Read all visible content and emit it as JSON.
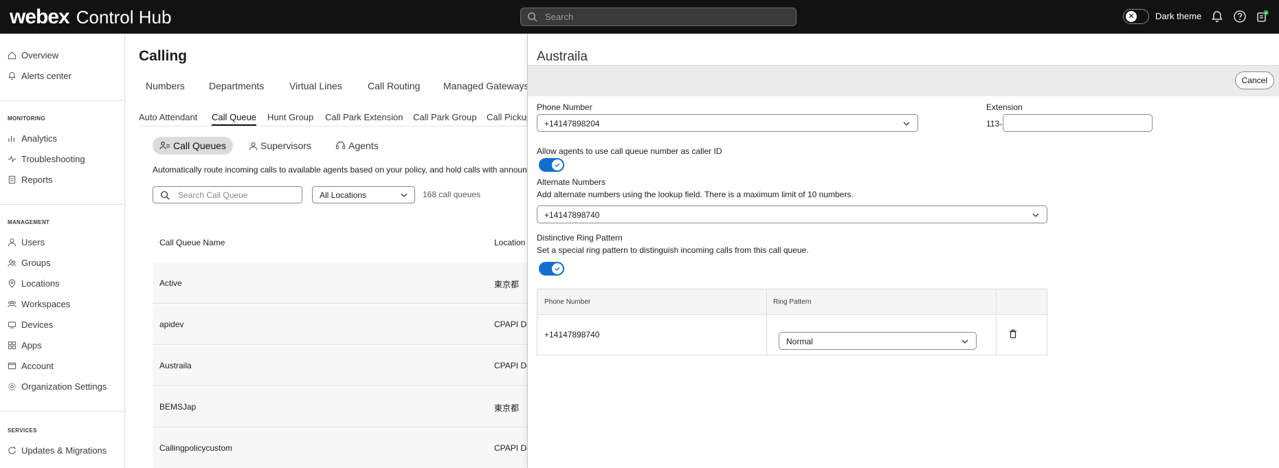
{
  "topbar": {
    "brand": "webex",
    "product": "Control Hub",
    "search_placeholder": "Search",
    "theme_label": "Dark theme"
  },
  "sidebar": {
    "items_top": [
      {
        "label": "Overview",
        "icon": "home-icon"
      },
      {
        "label": "Alerts center",
        "icon": "bell-icon"
      }
    ],
    "monitoring_title": "MONITORING",
    "monitoring": [
      {
        "label": "Analytics",
        "icon": "analytics-icon"
      },
      {
        "label": "Troubleshooting",
        "icon": "pulse-icon"
      },
      {
        "label": "Reports",
        "icon": "report-icon"
      }
    ],
    "management_title": "MANAGEMENT",
    "management": [
      {
        "label": "Users",
        "icon": "user-icon"
      },
      {
        "label": "Groups",
        "icon": "group-icon"
      },
      {
        "label": "Locations",
        "icon": "location-icon"
      },
      {
        "label": "Workspaces",
        "icon": "workspace-icon"
      },
      {
        "label": "Devices",
        "icon": "device-icon"
      },
      {
        "label": "Apps",
        "icon": "apps-icon"
      },
      {
        "label": "Account",
        "icon": "account-icon"
      },
      {
        "label": "Organization Settings",
        "icon": "gear-icon"
      }
    ],
    "services_title": "SERVICES",
    "services": [
      {
        "label": "Updates & Migrations",
        "icon": "refresh-icon"
      }
    ]
  },
  "main": {
    "title": "Calling",
    "tabs": [
      "Numbers",
      "Departments",
      "Virtual Lines",
      "Call Routing",
      "Managed Gateways"
    ],
    "subtabs": [
      "Auto Attendant",
      "Call Queue",
      "Hunt Group",
      "Call Park Extension",
      "Call Park Group",
      "Call Pickup"
    ],
    "active_subtab": "Call Queue",
    "pills": [
      "Call Queues",
      "Supervisors",
      "Agents"
    ],
    "description": "Automatically route incoming calls to available agents based on your policy, and hold calls with announcements",
    "search_placeholder": "Search Call Queue",
    "location_filter": "All Locations",
    "count": "168 call queues",
    "columns": [
      "Call Queue Name",
      "Location"
    ],
    "rows": [
      {
        "name": "Active",
        "location": "東京都"
      },
      {
        "name": "apidev",
        "location": "CPAPI Dev"
      },
      {
        "name": "Austraila",
        "location": "CPAPI Dev"
      },
      {
        "name": "BEMSJap",
        "location": "東京都"
      },
      {
        "name": "Callingpolicycustom",
        "location": "CPAPI Dev"
      }
    ]
  },
  "panel": {
    "title": "Austraila",
    "cancel_label": "Cancel",
    "phone_number_label": "Phone Number",
    "phone_number_value": "+14147898204",
    "extension_label": "Extension",
    "extension_prefix": "113-",
    "extension_value": "",
    "caller_id_label": "Allow agents to use call queue number as caller ID",
    "caller_id_enabled": true,
    "alt_numbers_label": "Alternate Numbers",
    "alt_numbers_desc": "Add alternate numbers using the lookup field. There is a maximum limit of 10 numbers.",
    "alt_numbers_value": "+14147898740",
    "ring_pattern_label": "Distinctive Ring Pattern",
    "ring_pattern_desc": "Set a special ring pattern to distinguish incoming calls from this call queue.",
    "ring_pattern_enabled": true,
    "ring_table": {
      "col_phone": "Phone Number",
      "col_pattern": "Ring Pattern",
      "row_phone": "+14147898740",
      "row_pattern": "Normal"
    }
  },
  "colors": {
    "topbar_bg": "#121212",
    "toggle_on": "#1170cf"
  }
}
